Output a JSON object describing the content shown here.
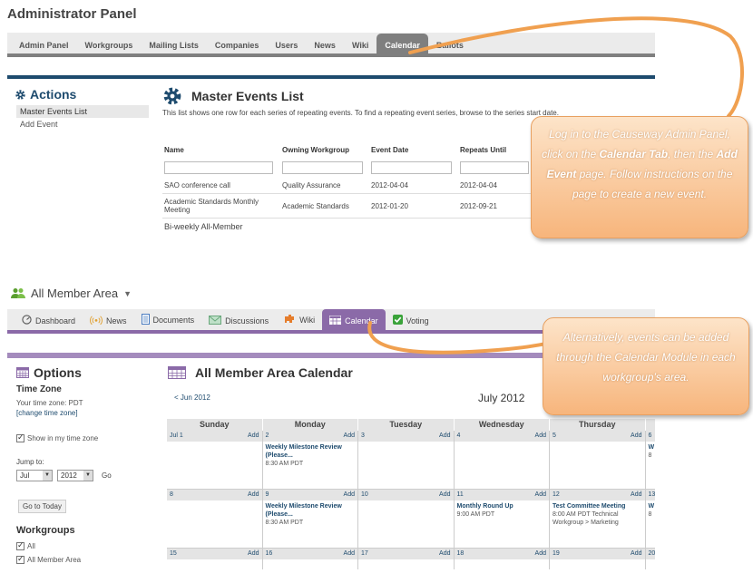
{
  "admin": {
    "title": "Administrator Panel",
    "tabs": [
      "Admin Panel",
      "Workgroups",
      "Mailing Lists",
      "Companies",
      "Users",
      "News",
      "Wiki",
      "Calendar",
      "Ballots"
    ],
    "active_tab": "Calendar",
    "actions_title": "Actions",
    "actions": [
      "Master Events List",
      "Add Event"
    ],
    "list_title": "Master Events List",
    "list_desc": "This list shows one row for each series of repeating events. To find a repeating event series, browse to the series start date.",
    "columns": [
      "Name",
      "Owning Workgroup",
      "Event Date",
      "Repeats Until"
    ],
    "rows": [
      {
        "name": "SAO conference call",
        "group": "Quality Assurance",
        "date": "2012-04-04",
        "until": "2012-04-04"
      },
      {
        "name": "Academic Standards Monthly Meeting",
        "group": "Academic Standards",
        "date": "2012-01-20",
        "until": "2012-09-21"
      },
      {
        "name": "Bi-weekly All-Member",
        "group": "",
        "date": "",
        "until": ""
      }
    ]
  },
  "callout1": {
    "p1": "Log in to the Causeway Admin Panel, click on the ",
    "b1": "Calendar Tab",
    "p2": ", then the ",
    "b2": "Add Event",
    "p3": " page. Follow instructions on the page to create a new event."
  },
  "ama": {
    "title": "All Member Area",
    "tabs": [
      {
        "label": "Dashboard",
        "icon": "dashboard-icon"
      },
      {
        "label": "News",
        "icon": "news-icon"
      },
      {
        "label": "Documents",
        "icon": "document-icon"
      },
      {
        "label": "Discussions",
        "icon": "discussion-icon"
      },
      {
        "label": "Wiki",
        "icon": "wiki-icon"
      },
      {
        "label": "Calendar",
        "icon": "calendar-icon"
      },
      {
        "label": "Voting",
        "icon": "voting-icon"
      }
    ],
    "active_tab": "Calendar",
    "options_title": "Options",
    "timezone_heading": "Time Zone",
    "timezone_text": "Your time zone: PDT",
    "timezone_link": "[change time zone]",
    "show_tz": "Show in my time zone",
    "jump_to": "Jump to:",
    "jump_month": "Jul",
    "jump_year": "2012",
    "go": "Go",
    "go_today": "Go to Today",
    "workgroups_heading": "Workgroups",
    "workgroups": [
      "All",
      "All Member Area"
    ],
    "cal_title": "All Member Area Calendar",
    "prev_month": "< Jun 2012",
    "month_label": "July 2012",
    "days": [
      "Sunday",
      "Monday",
      "Tuesday",
      "Wednesday",
      "Thursday",
      ""
    ],
    "add_label": "Add",
    "weeks": [
      [
        {
          "n": "Jul 1",
          "events": []
        },
        {
          "n": "2",
          "events": [
            {
              "t": "Weekly Milestone Review (Please...",
              "time": "8:30 AM PDT"
            }
          ]
        },
        {
          "n": "3",
          "events": []
        },
        {
          "n": "4",
          "events": []
        },
        {
          "n": "5",
          "events": []
        },
        {
          "n": "6",
          "events": [
            {
              "t": "W",
              "time": "8"
            }
          ]
        }
      ],
      [
        {
          "n": "8",
          "events": []
        },
        {
          "n": "9",
          "events": [
            {
              "t": "Weekly Milestone Review (Please...",
              "time": "8:30 AM PDT"
            }
          ]
        },
        {
          "n": "10",
          "events": []
        },
        {
          "n": "11",
          "events": [
            {
              "t": "Monthly Round Up",
              "time": "9:00 AM PDT"
            }
          ]
        },
        {
          "n": "12",
          "events": [
            {
              "t": "Test Committee Meeting",
              "time": "8:00 AM PDT Technical Workgroup > Marketing"
            }
          ]
        },
        {
          "n": "13",
          "events": [
            {
              "t": "W",
              "time": "8"
            }
          ]
        }
      ],
      [
        {
          "n": "15",
          "events": []
        },
        {
          "n": "16",
          "events": []
        },
        {
          "n": "17",
          "events": []
        },
        {
          "n": "18",
          "events": []
        },
        {
          "n": "19",
          "events": []
        },
        {
          "n": "20",
          "events": []
        }
      ]
    ]
  },
  "callout2": {
    "text": "Alternatively, events can be added through the Calendar Module in each workgroup’s area."
  },
  "colors": {
    "admin_accent": "#1e4b6e",
    "ama_accent": "#8b6aa8",
    "callout": "#f7b57c",
    "arrow": "#f0a050"
  }
}
